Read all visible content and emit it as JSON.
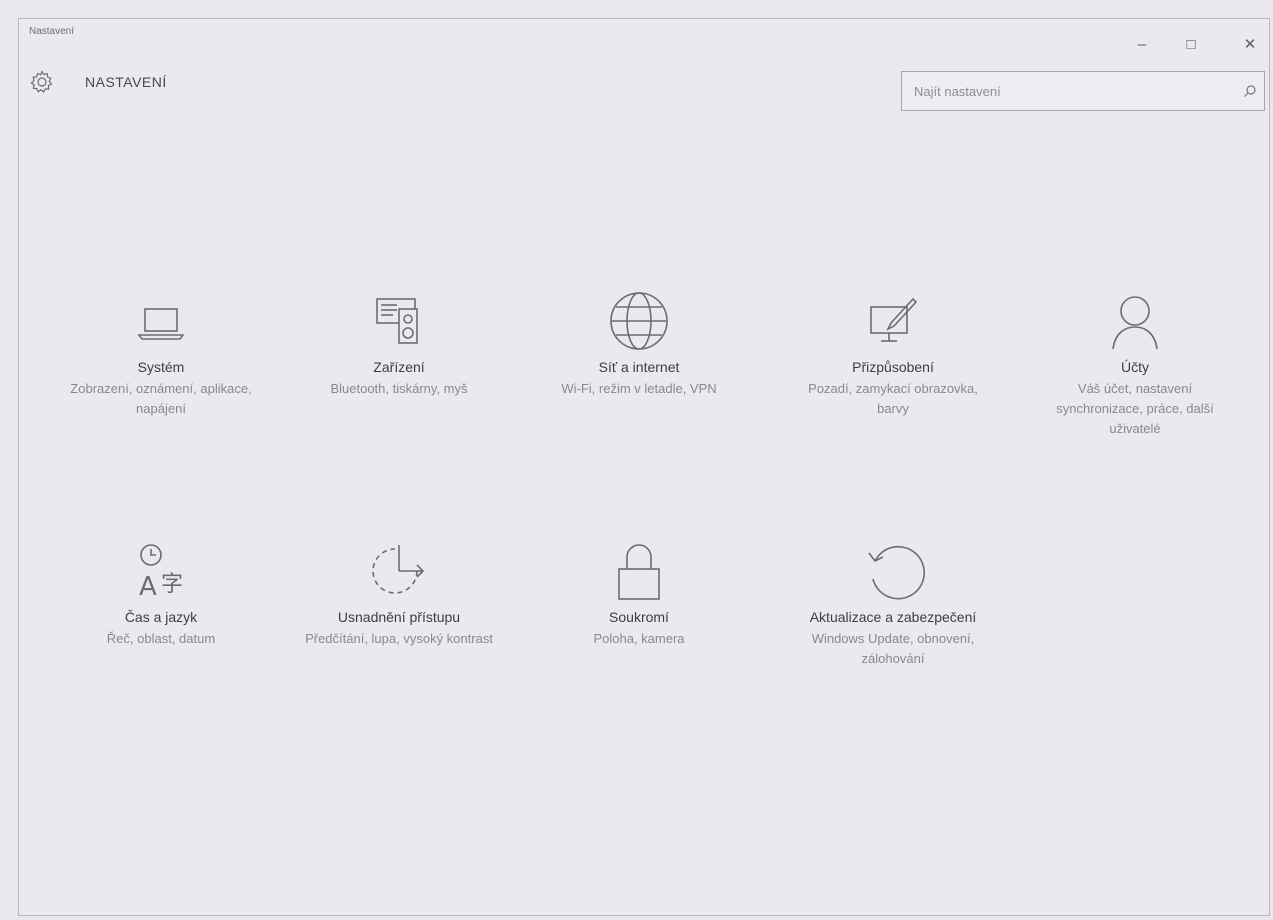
{
  "window": {
    "title": "Nastavení",
    "minimize_glyph": "–",
    "maximize_glyph": "□",
    "close_glyph": "✕"
  },
  "header": {
    "title": "NASTAVENÍ",
    "icon": "gear-icon"
  },
  "search": {
    "placeholder": "Najít nastavení",
    "value": "",
    "icon": "search-icon"
  },
  "tiles": [
    {
      "label": "Systém",
      "desc": "Zobrazení, oznámení, aplikace, napájení",
      "icon": "laptop-icon"
    },
    {
      "label": "Zařízení",
      "desc": "Bluetooth, tiskárny, myš",
      "icon": "devices-icon"
    },
    {
      "label": "Síť a internet",
      "desc": "Wi-Fi, režim v letadle, VPN",
      "icon": "globe-icon"
    },
    {
      "label": "Přizpůsobení",
      "desc": "Pozadí, zamykací obrazovka, barvy",
      "icon": "paint-icon"
    },
    {
      "label": "Účty",
      "desc": "Váš účet, nastavení synchronizace, práce, další uživatelé",
      "icon": "person-icon"
    },
    {
      "label": "Čas a jazyk",
      "desc": "Řeč, oblast, datum",
      "icon": "time-language-icon"
    },
    {
      "label": "Usnadnění přístupu",
      "desc": "Předčítání, lupa, vysoký kontrast",
      "icon": "ease-of-access-icon"
    },
    {
      "label": "Soukromí",
      "desc": "Poloha, kamera",
      "icon": "lock-icon"
    },
    {
      "label": "Aktualizace a zabezpečení",
      "desc": "Windows Update, obnovení, zálohování",
      "icon": "update-icon"
    }
  ],
  "colors": {
    "background": "#ebe8ee",
    "text": "#3f3c42",
    "subtext": "#8a8790",
    "icon_stroke": "#6e6b72"
  }
}
